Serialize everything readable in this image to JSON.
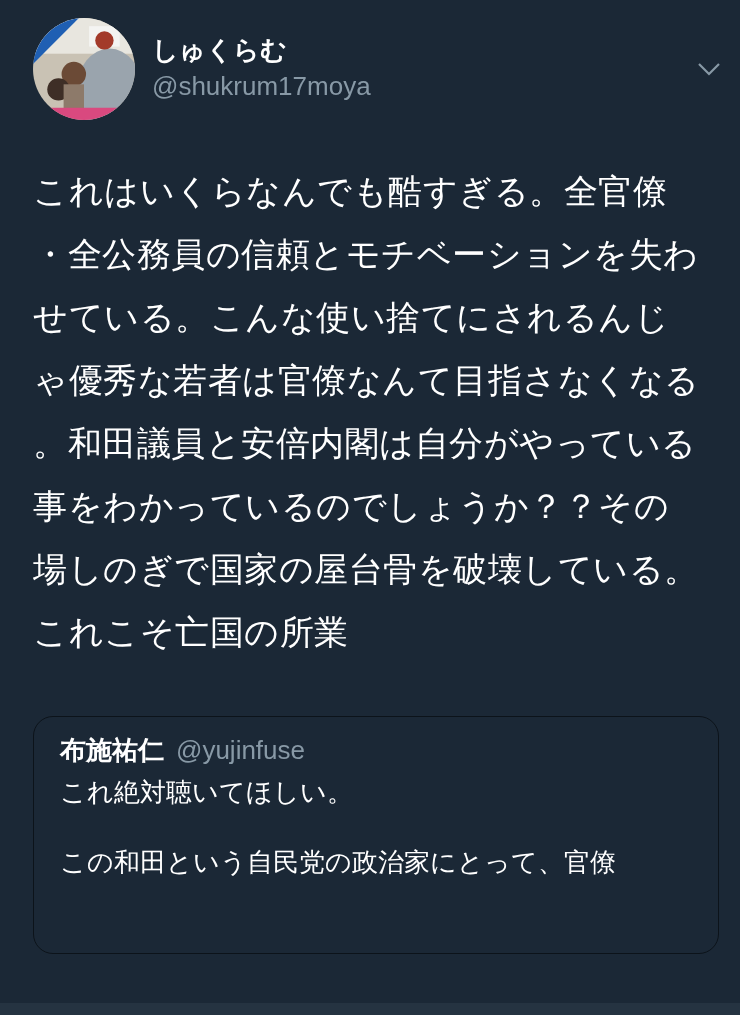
{
  "author": {
    "display_name": "しゅくらむ",
    "handle": "@shukrum17moya"
  },
  "tweet_text": "これはいくらなんでも酷すぎる。全官僚・全公務員の信頼とモチベーションを失わせている。こんな使い捨てにされるんじゃ優秀な若者は官僚なんて目指さなくなる。和田議員と安倍内閣は自分がやっている事をわかっているのでしょうか？？その場しのぎで国家の屋台骨を破壊している。これこそ亡国の所業",
  "quoted_tweet": {
    "display_name": "布施祐仁",
    "handle": "@yujinfuse",
    "paragraphs": [
      "これ絶対聴いてほしい。",
      "この和田という自民党の政治家にとって、官僚"
    ]
  }
}
